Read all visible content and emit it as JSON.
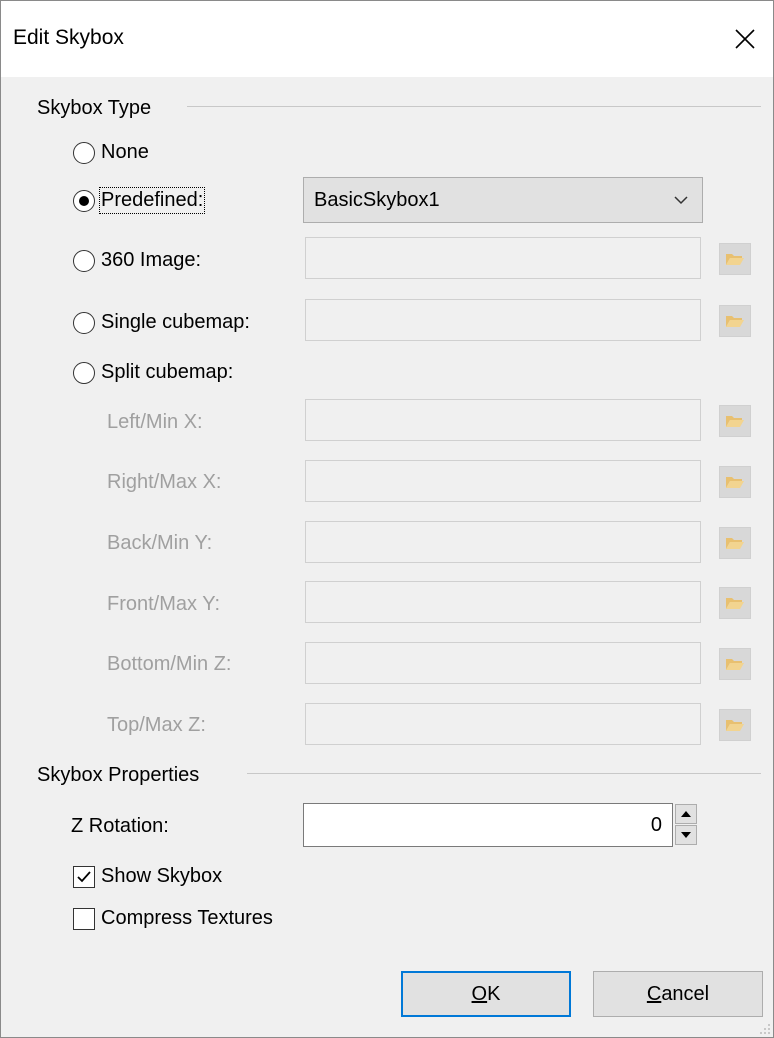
{
  "dialog": {
    "title": "Edit Skybox",
    "close_glyph": "✕"
  },
  "skybox_type": {
    "header": "Skybox Type",
    "options": [
      {
        "label": "None",
        "selected": false
      },
      {
        "label": "Predefined:",
        "selected": true
      },
      {
        "label": "360 Image:",
        "selected": false
      },
      {
        "label": "Single cubemap:",
        "selected": false
      },
      {
        "label": "Split cubemap:",
        "selected": false
      }
    ],
    "predefined_value": "BasicSkybox1",
    "image_360_value": "",
    "single_cubemap_value": "",
    "split_faces": [
      {
        "label": "Left/Min X:",
        "value": ""
      },
      {
        "label": "Right/Max X:",
        "value": ""
      },
      {
        "label": "Back/Min Y:",
        "value": ""
      },
      {
        "label": "Front/Max Y:",
        "value": ""
      },
      {
        "label": "Bottom/Min Z:",
        "value": ""
      },
      {
        "label": "Top/Max Z:",
        "value": ""
      }
    ]
  },
  "skybox_properties": {
    "header": "Skybox Properties",
    "z_rotation_label": "Z Rotation:",
    "z_rotation_value": "0",
    "show_skybox_label": "Show Skybox",
    "show_skybox_checked": true,
    "compress_textures_label": "Compress Textures",
    "compress_textures_checked": false
  },
  "buttons": {
    "ok_mnemonic": "O",
    "ok_rest": "K",
    "cancel_mnemonic": "C",
    "cancel_rest": "ancel"
  },
  "colors": {
    "accent": "#0078d7",
    "folder_icon": "#e8c070",
    "disabled_text": "#a0a0a0"
  },
  "icons": {
    "browse": "folder-open-icon",
    "dropdown": "chevron-down-icon",
    "spin_up": "triangle-up-icon",
    "spin_down": "triangle-down-icon",
    "check": "checkmark-icon"
  }
}
